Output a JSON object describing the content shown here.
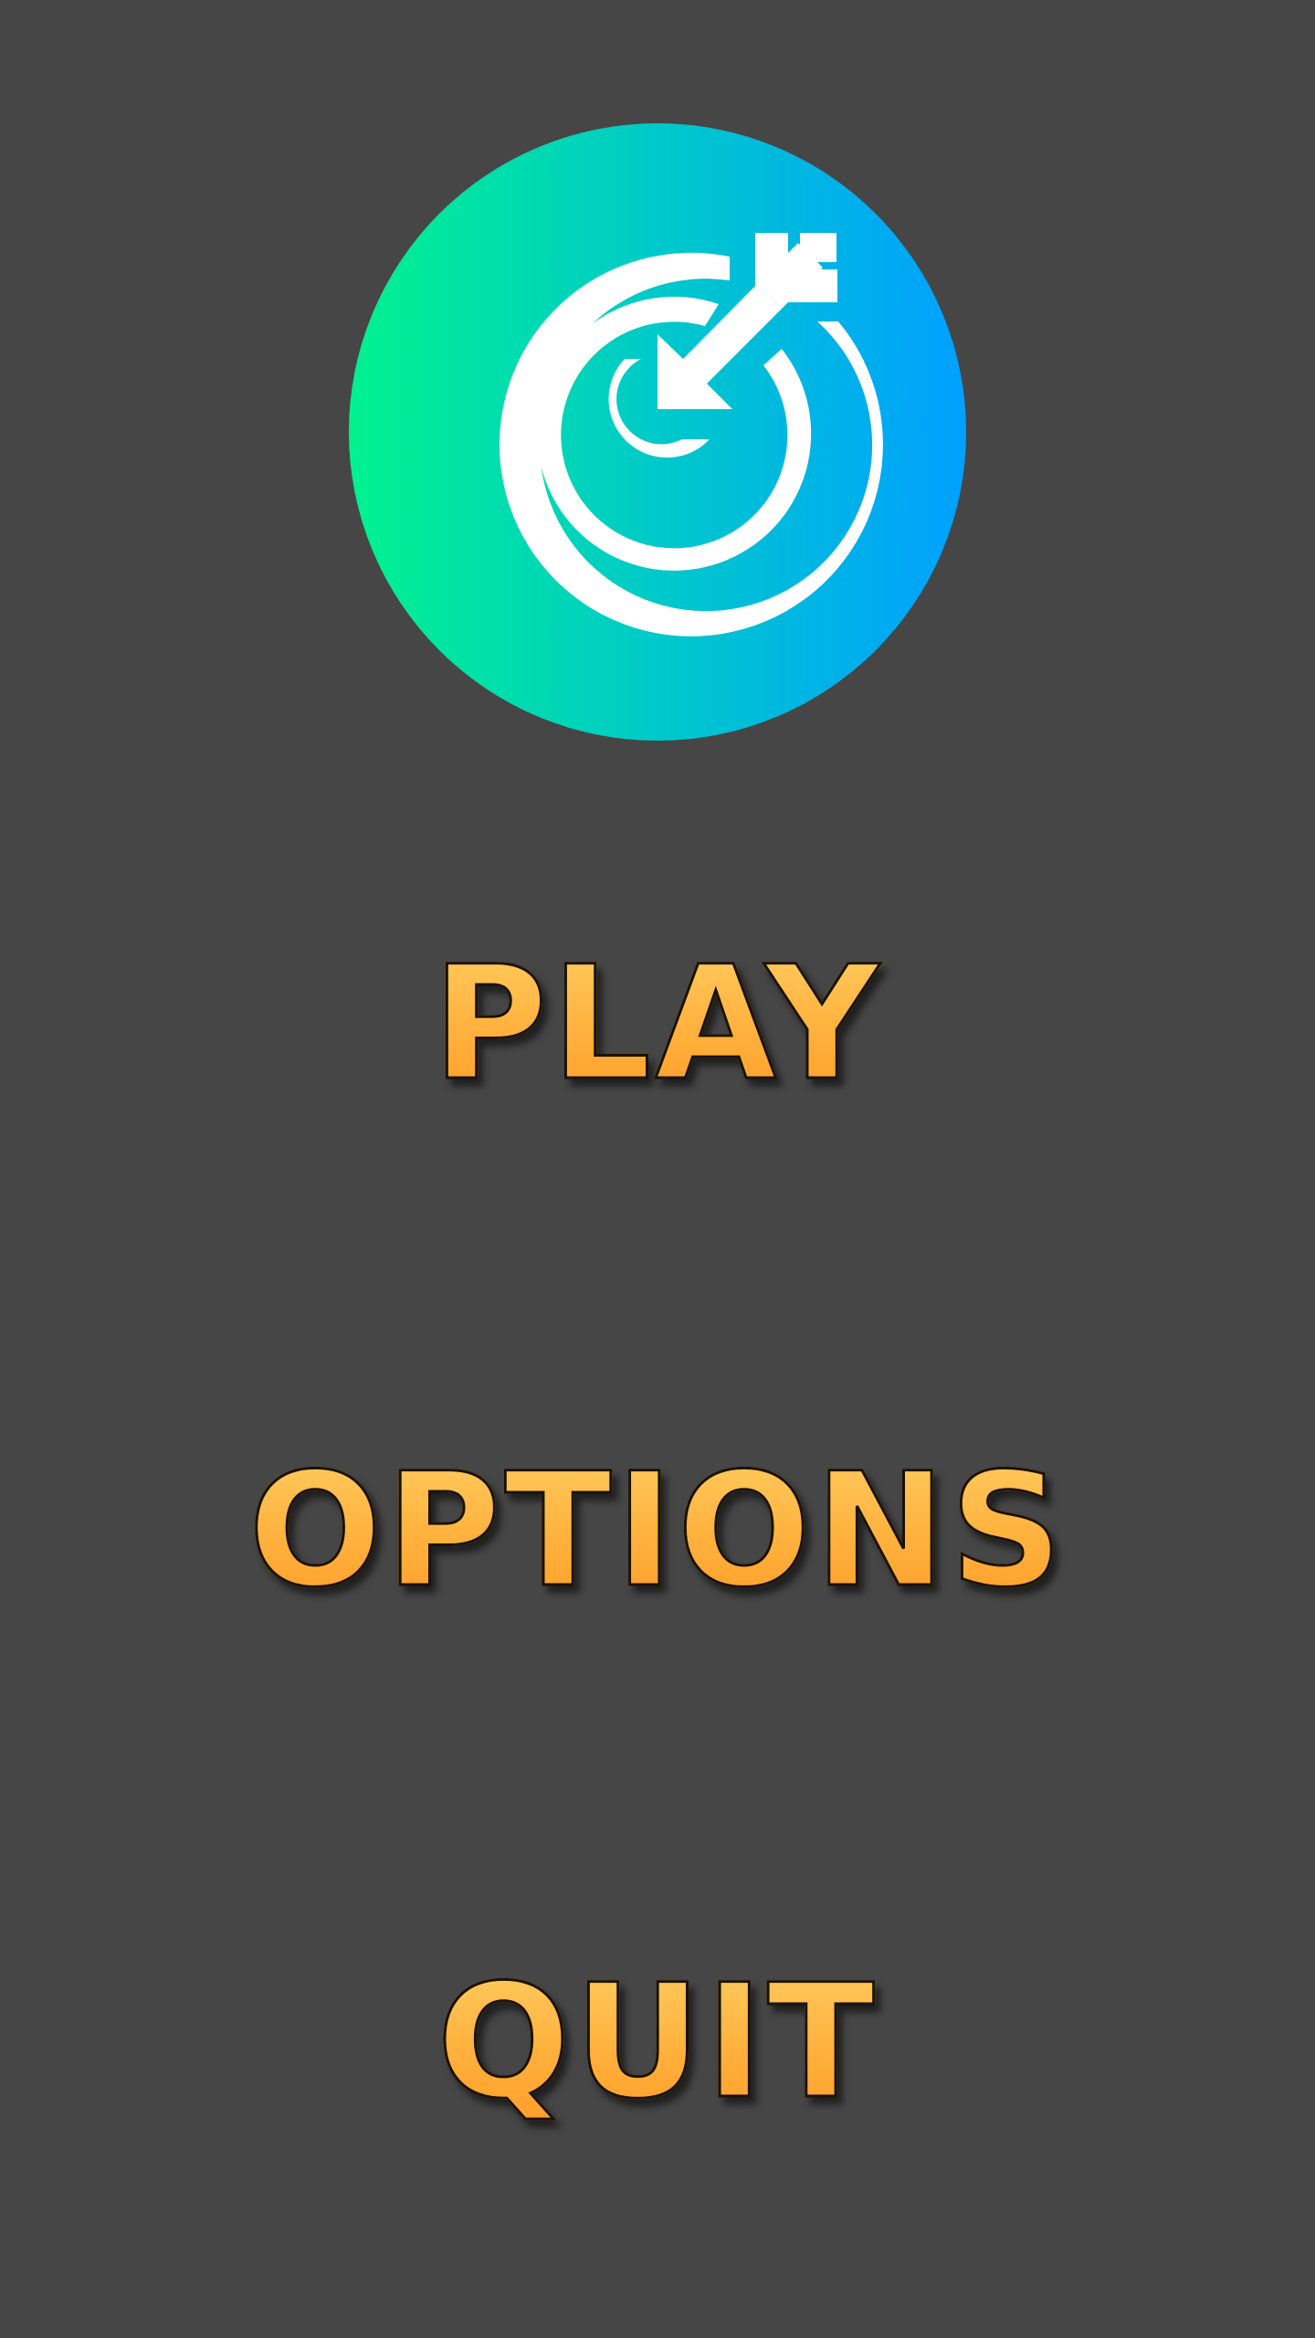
{
  "screen": "main-menu",
  "colors": {
    "background": "#464646",
    "logo_gradient_start": "#00f28f",
    "logo_gradient_end": "#00a0ff",
    "button_text_top": "#ffcb5e",
    "button_text_bottom": "#ff9f2a",
    "button_outline": "#1a1206"
  },
  "logo": {
    "icon": "target-arrow-icon"
  },
  "menu": {
    "play_label": "PLAY",
    "options_label": "OPTIONS",
    "quit_label": "QUIT"
  }
}
